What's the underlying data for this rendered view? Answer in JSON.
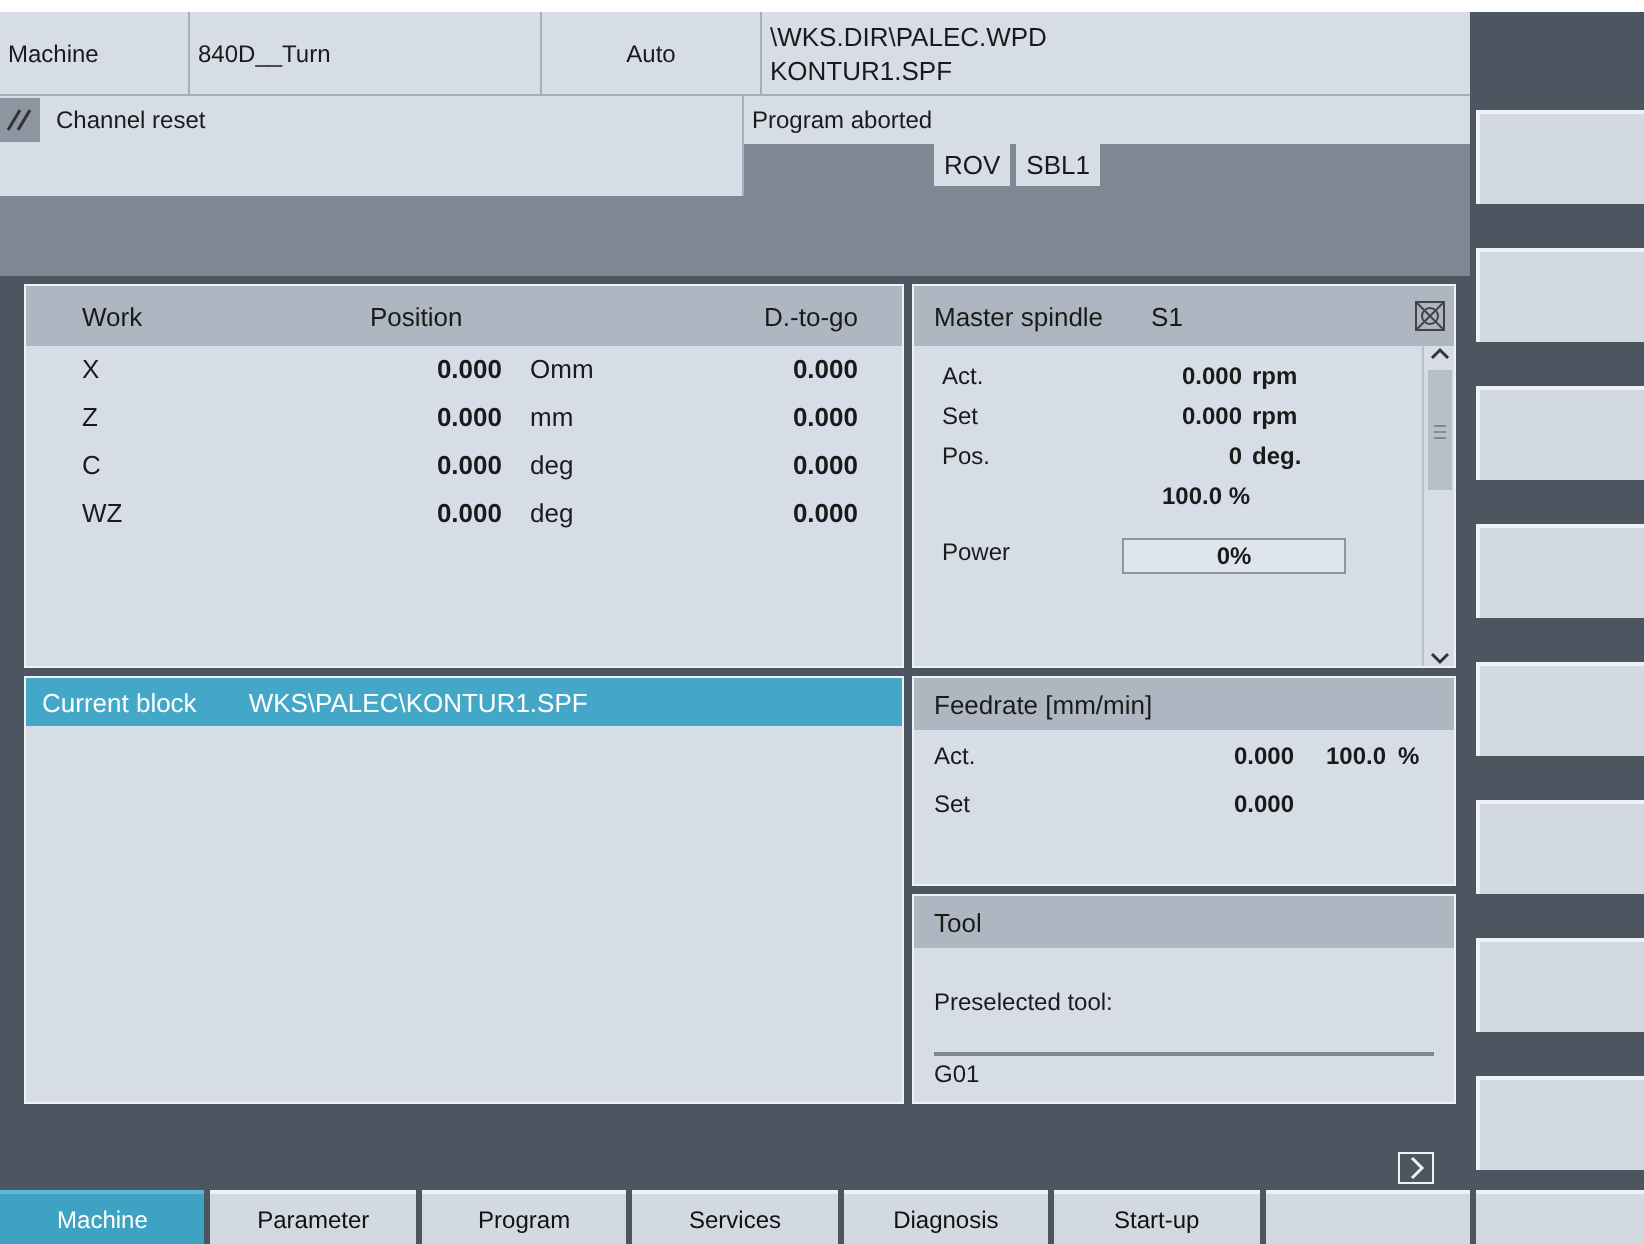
{
  "header": {
    "area": "Machine",
    "channel": "840D__Turn",
    "mode": "Auto",
    "program_path": [
      "\\WKS.DIR\\PALEC.WPD",
      "KONTUR1.SPF"
    ],
    "channel_status": "Channel reset",
    "program_status": "Program aborted",
    "flags": [
      "ROV",
      "SBL1"
    ]
  },
  "position": {
    "columns": [
      "Work",
      "Position",
      "D.-to-go"
    ],
    "rows": [
      {
        "axis": "X",
        "value": "0.000",
        "unit": "Omm",
        "dtg": "0.000"
      },
      {
        "axis": "Z",
        "value": "0.000",
        "unit": "mm",
        "dtg": "0.000"
      },
      {
        "axis": "C",
        "value": "0.000",
        "unit": "deg",
        "dtg": "0.000"
      },
      {
        "axis": "WZ",
        "value": "0.000",
        "unit": "deg",
        "dtg": "0.000"
      }
    ]
  },
  "spindle": {
    "title": "Master spindle",
    "id": "S1",
    "rows": [
      {
        "label": "Act.",
        "value": "0.000",
        "unit": "rpm"
      },
      {
        "label": "Set",
        "value": "0.000",
        "unit": "rpm"
      },
      {
        "label": "Pos.",
        "value": "0",
        "unit": "deg."
      }
    ],
    "override": "100.0 %",
    "power_label": "Power",
    "power": {
      "level": 0,
      "reading": "0%"
    }
  },
  "current_block": {
    "label": "Current block",
    "path": "WKS\\PALEC\\KONTUR1.SPF"
  },
  "feedrate": {
    "title": "Feedrate [mm/min]",
    "rows": [
      {
        "label": "Act.",
        "value": "0.000",
        "override": "100.0",
        "unit": "%"
      },
      {
        "label": "Set",
        "value": "0.000"
      }
    ]
  },
  "tool": {
    "title": "Tool",
    "preselected_label": "Preselected tool:",
    "gcode": "G01"
  },
  "tabs": [
    {
      "label": "Machine",
      "selected": true
    },
    {
      "label": "Parameter",
      "selected": false
    },
    {
      "label": "Program",
      "selected": false
    },
    {
      "label": "Services",
      "selected": false
    },
    {
      "label": "Diagnosis",
      "selected": false
    },
    {
      "label": "Start-up",
      "selected": false
    }
  ]
}
